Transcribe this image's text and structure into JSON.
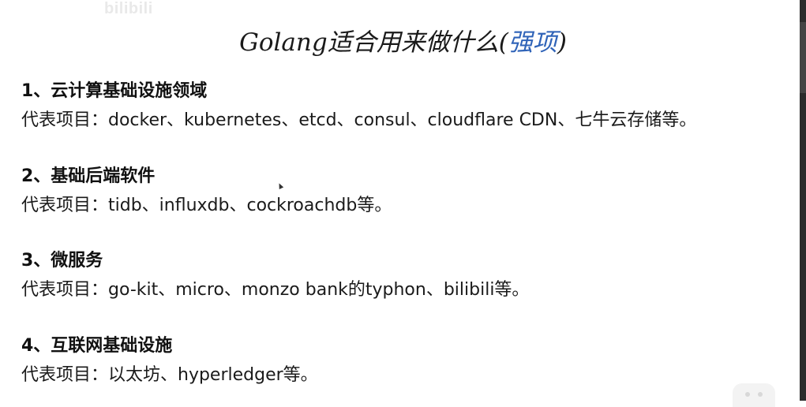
{
  "watermark": "bilibili",
  "title": {
    "main": "Golang适合用来做什么(",
    "accent": "强项",
    "close": ")"
  },
  "sections": [
    {
      "heading": "1、云计算基础设施领域",
      "body": "代表项目：docker、kubernetes、etcd、consul、cloudflare CDN、七牛云存储等。"
    },
    {
      "heading": "2、基础后端软件",
      "body": "代表项目：tidb、influxdb、cockroachdb等。"
    },
    {
      "heading": "3、微服务",
      "body": "代表项目：go-kit、micro、monzo bank的typhon、bilibili等。"
    },
    {
      "heading": "4、互联网基础设施",
      "body": "代表项目：以太坊、hyperledger等。"
    }
  ],
  "colors": {
    "accent": "#2f63b8",
    "text": "#1a1a1a",
    "background": "#ffffff"
  },
  "icons": [
    "pointer-cursor-icon",
    "chat-bubble-icon"
  ]
}
